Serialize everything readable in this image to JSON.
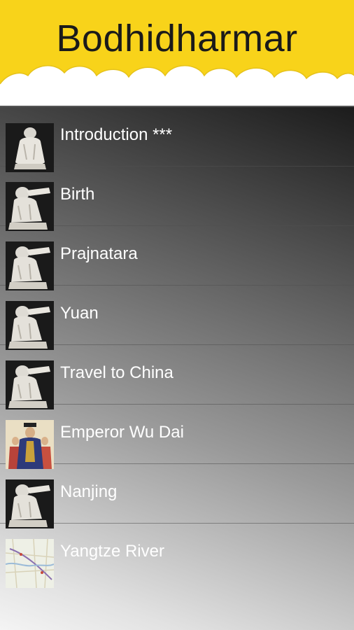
{
  "header": {
    "title": "Bodhidharmar"
  },
  "items": [
    {
      "label": "Introduction ***",
      "thumb_icon": "statue-icon"
    },
    {
      "label": "Birth",
      "thumb_icon": "statue-icon"
    },
    {
      "label": "Prajnatara",
      "thumb_icon": "statue-icon"
    },
    {
      "label": "Yuan",
      "thumb_icon": "statue-icon"
    },
    {
      "label": "Travel to China",
      "thumb_icon": "statue-icon"
    },
    {
      "label": "Emperor Wu Dai",
      "thumb_icon": "emperor-painting-icon"
    },
    {
      "label": "Nanjing",
      "thumb_icon": "statue-icon"
    },
    {
      "label": "Yangtze River",
      "thumb_icon": "map-icon"
    }
  ],
  "colors": {
    "header_bg": "#f8d31a",
    "label": "#ffffff"
  }
}
